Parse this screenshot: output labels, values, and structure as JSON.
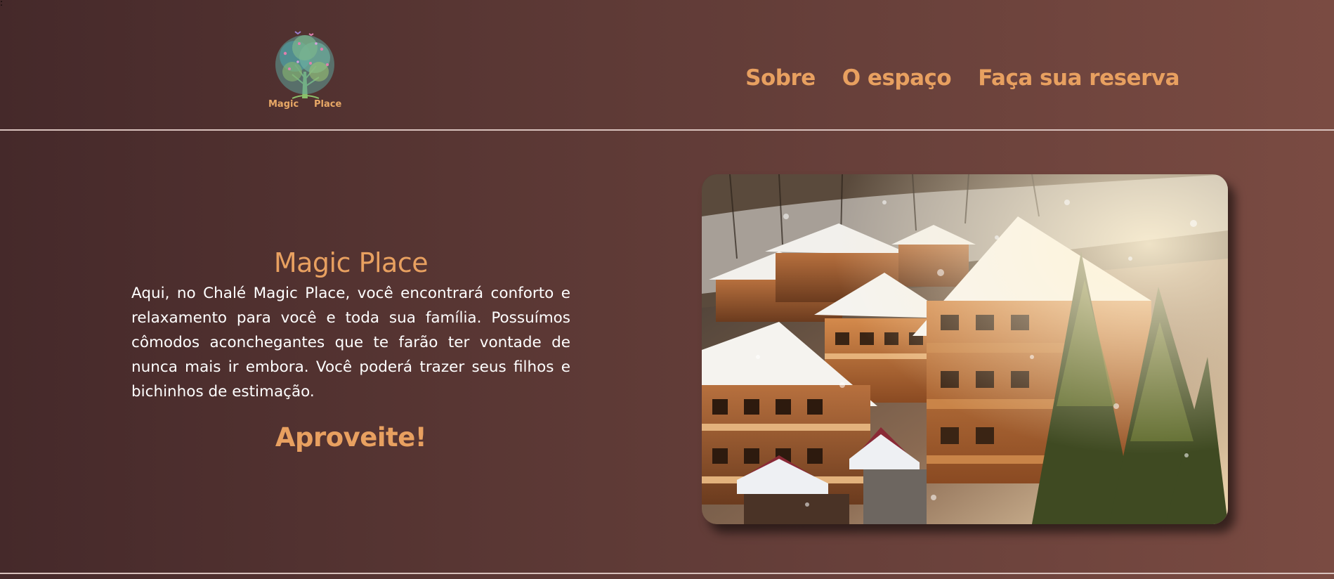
{
  "stray_char": ":",
  "header": {
    "logo": {
      "text_left": "Magic",
      "text_right": "Place",
      "icon": "tree-icon"
    },
    "nav": [
      {
        "label": "Sobre"
      },
      {
        "label": "O espaço"
      },
      {
        "label": "Faça sua reserva"
      }
    ]
  },
  "main": {
    "title": "Magic Place",
    "body": "Aqui, no Chalé Magic Place, você encontrará conforto e relaxamento para você e toda sua família. Possuímos cômodos aconchegantes que te farão ter vontade de nunca mais ir embora. Você poderá trazer seus filhos e bichinhos de estimação.",
    "cta": "Aproveite!",
    "image": "snowy-chalet-image"
  },
  "colors": {
    "accent": "#e8a060",
    "background_start": "#45292a",
    "background_end": "#7a4b42",
    "divider": "#d9c2bd"
  }
}
